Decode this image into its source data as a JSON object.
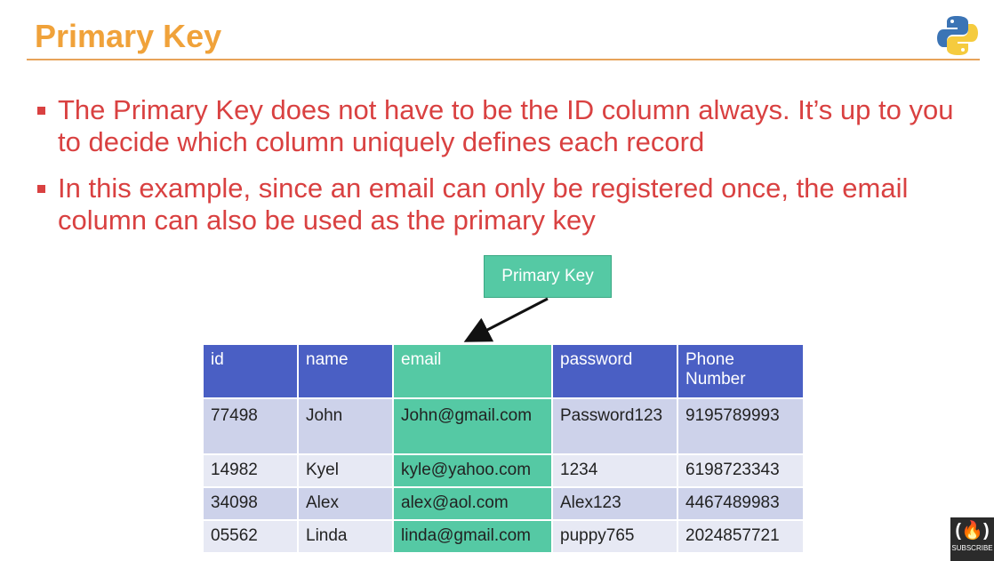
{
  "slide": {
    "title": "Primary Key",
    "bullets": [
      "The Primary Key does not have to be the ID column always. It’s up to you to decide which column uniquely defines each record",
      "In this example, since an email can only be registered once, the email column can also be used as the primary key"
    ],
    "callout": "Primary Key",
    "logo_icon": "python-logo-icon",
    "accent_color": "#f0a23a",
    "bullet_color": "#d94141",
    "header_color": "#4a5fc4",
    "highlight_color": "#55c9a4"
  },
  "table": {
    "headers": [
      "id",
      "name",
      "email",
      "password",
      "Phone Number"
    ],
    "rows": [
      [
        "77498",
        "John",
        "John@gmail.com",
        "Password123",
        "9195789993"
      ],
      [
        "14982",
        "Kyel",
        "kyle@yahoo.com",
        "1234",
        "6198723343"
      ],
      [
        "34098",
        "Alex",
        "alex@aol.com",
        "Alex123",
        "4467489983"
      ],
      [
        "05562",
        "Linda",
        "linda@gmail.com",
        "puppy765",
        "2024857721"
      ]
    ]
  },
  "subscribe": {
    "label": "SUBSCRIBE",
    "glyph": "(🔥)"
  }
}
